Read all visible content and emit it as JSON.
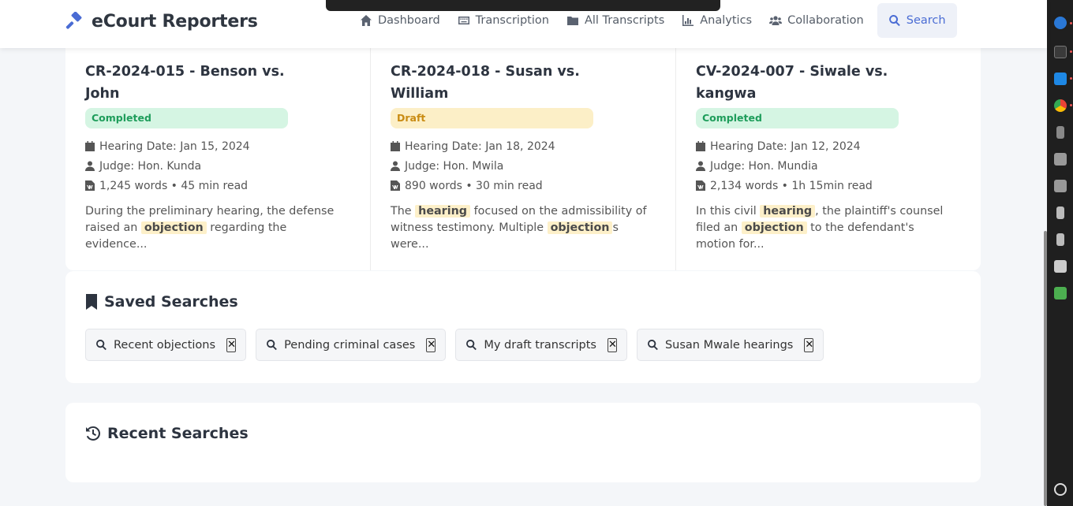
{
  "brand": {
    "name": "eCourt Reporters"
  },
  "nav": [
    {
      "label": "Dashboard",
      "icon": "home-icon"
    },
    {
      "label": "Transcription",
      "icon": "keyboard-icon"
    },
    {
      "label": "All Transcripts",
      "icon": "folder-icon"
    },
    {
      "label": "Analytics",
      "icon": "chart-icon"
    },
    {
      "label": "Collaboration",
      "icon": "users-icon"
    },
    {
      "label": "Search",
      "icon": "search-icon",
      "active": true
    }
  ],
  "cases": [
    {
      "title": "CR-2024-015 - Benson vs. John",
      "status": "Completed",
      "hearing_date": "Hearing Date: Jan 15, 2024",
      "judge": "Judge: Hon. Kunda",
      "words": "1,245 words • 45 min read",
      "excerpt": [
        {
          "t": "During the preliminary hearing, the defense raised an "
        },
        {
          "t": "objection",
          "hl": true
        },
        {
          "t": " regarding the evidence..."
        }
      ]
    },
    {
      "title": "CR-2024-018 - Susan vs. William",
      "status": "Draft",
      "hearing_date": "Hearing Date: Jan 18, 2024",
      "judge": "Judge: Hon. Mwila",
      "words": "890 words • 30 min read",
      "excerpt": [
        {
          "t": "The "
        },
        {
          "t": "hearing",
          "hl": true
        },
        {
          "t": " focused on the admissibility of witness testimony. Multiple "
        },
        {
          "t": "objection",
          "hl": true
        },
        {
          "t": "s were..."
        }
      ]
    },
    {
      "title": "CV-2024-007 - Siwale vs. kangwa",
      "status": "Completed",
      "hearing_date": "Hearing Date: Jan 12, 2024",
      "judge": "Judge: Hon. Mundia",
      "words": "2,134 words • 1h 15min read",
      "excerpt": [
        {
          "t": "In this civil "
        },
        {
          "t": "hearing",
          "hl": true
        },
        {
          "t": ", the plaintiff's counsel filed an "
        },
        {
          "t": "objection",
          "hl": true
        },
        {
          "t": " to the defendant's motion for..."
        }
      ]
    }
  ],
  "saved": {
    "title": "Saved Searches",
    "items": [
      "Recent objections",
      "Pending criminal cases",
      "My draft transcripts",
      "Susan Mwale hearings"
    ],
    "remove_label": "✕"
  },
  "recent": {
    "title": "Recent Searches"
  },
  "colors": {
    "accent": "#4a6cd4",
    "completed_bg": "#d5f5e3",
    "completed_fg": "#1e9d5b",
    "draft_bg": "#fcefc7",
    "draft_fg": "#c98b12",
    "highlight": "#fdf0c9"
  }
}
